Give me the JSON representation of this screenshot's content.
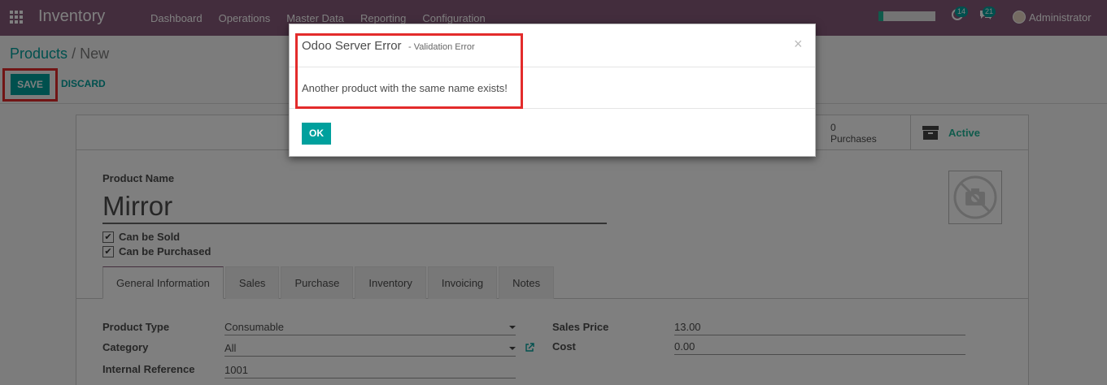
{
  "navbar": {
    "brand": "Inventory",
    "menu": [
      "Dashboard",
      "Operations",
      "Master Data",
      "Reporting",
      "Configuration"
    ],
    "activity_count": "14",
    "messages_count": "21",
    "user": "Administrator",
    "progress_fraction": 0.08
  },
  "breadcrumb": {
    "parent": "Products",
    "separator": "/",
    "current": "New"
  },
  "toolbar": {
    "save_label": "SAVE",
    "discard_label": "DISCARD"
  },
  "stat_buttons": {
    "purchases_count": "0",
    "purchases_label": "Purchases",
    "active_label": "Active"
  },
  "form": {
    "name_label": "Product Name",
    "name_value": "Mirror",
    "can_be_sold": "Can be Sold",
    "can_be_purchased": "Can be Purchased",
    "tabs": [
      "General Information",
      "Sales",
      "Purchase",
      "Inventory",
      "Invoicing",
      "Notes"
    ],
    "fields": {
      "product_type_label": "Product Type",
      "product_type_value": "Consumable",
      "category_label": "Category",
      "category_value": "All",
      "internal_ref_label": "Internal Reference",
      "internal_ref_value": "1001",
      "sales_price_label": "Sales Price",
      "sales_price_value": "13.00",
      "cost_label": "Cost",
      "cost_value": "0.00"
    }
  },
  "modal": {
    "title": "Odoo Server Error",
    "subtitle": "- Validation Error",
    "close": "×",
    "message": "Another product with the same name exists!",
    "ok_label": "OK"
  },
  "colors": {
    "navbar": "#875a7b",
    "primary": "#00a09d",
    "highlight": "#e32b2b",
    "active_green": "#21b799"
  }
}
